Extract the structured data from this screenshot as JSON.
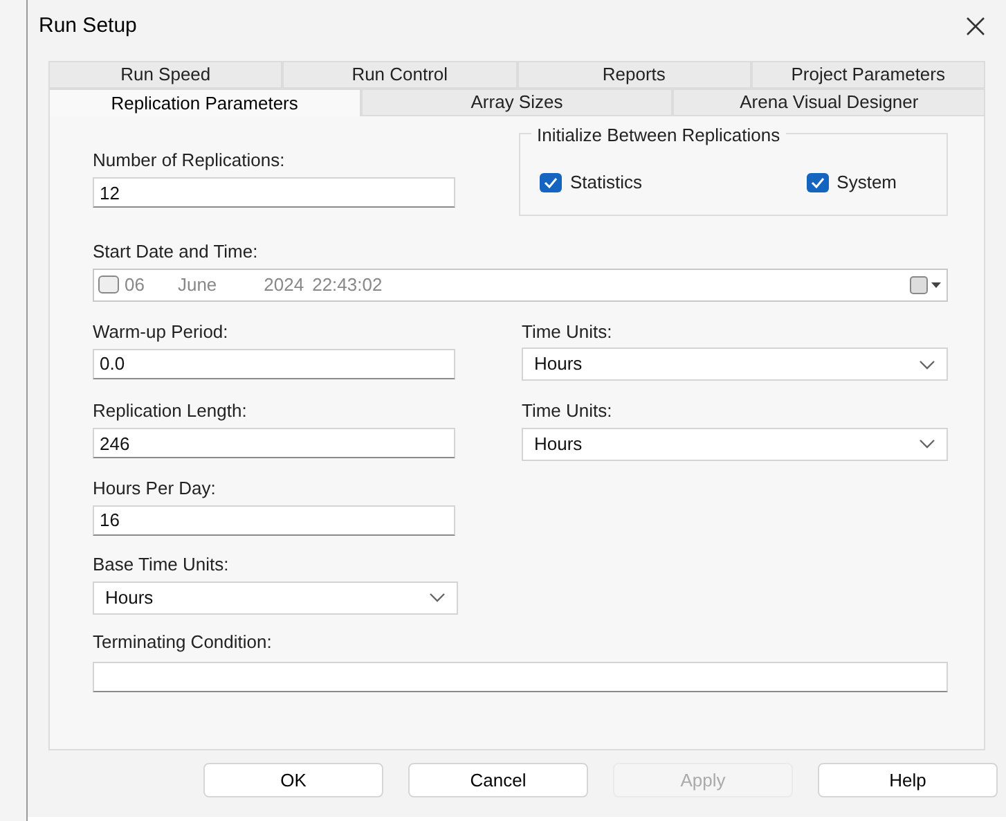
{
  "window": {
    "title": "Run Setup"
  },
  "tab_rows": [
    {
      "tabs": [
        {
          "label": "Run Speed",
          "selected": false
        },
        {
          "label": "Run Control",
          "selected": false
        },
        {
          "label": "Reports",
          "selected": false
        },
        {
          "label": "Project Parameters",
          "selected": false
        }
      ]
    },
    {
      "tabs": [
        {
          "label": "Replication Parameters",
          "selected": true
        },
        {
          "label": "Array Sizes",
          "selected": false
        },
        {
          "label": "Arena Visual Designer",
          "selected": false
        }
      ]
    }
  ],
  "number_of_replications": {
    "label": "Number of Replications:",
    "value": "12"
  },
  "initialize_group": {
    "title": "Initialize Between Replications",
    "options": [
      {
        "label": "Statistics",
        "checked": true
      },
      {
        "label": "System",
        "checked": true
      }
    ]
  },
  "start_date": {
    "label": "Start Date and Time:",
    "checked": false,
    "day": "06",
    "month": "June",
    "year": "2024",
    "time": "22:43:02"
  },
  "warm_up": {
    "label": "Warm-up Period:",
    "value": "0.0",
    "units_label": "Time Units:",
    "units": "Hours"
  },
  "replication_length": {
    "label": "Replication Length:",
    "value": "246",
    "units_label": "Time Units:",
    "units": "Hours"
  },
  "hours_per_day": {
    "label": "Hours Per Day:",
    "value": "16"
  },
  "base_time_units": {
    "label": "Base Time Units:",
    "value": "Hours"
  },
  "terminating_condition": {
    "label": "Terminating Condition:"
  },
  "buttons": [
    {
      "label": "OK",
      "disabled": false
    },
    {
      "label": "Cancel",
      "disabled": false
    },
    {
      "label": "Apply",
      "disabled": true
    },
    {
      "label": "Help",
      "disabled": false
    }
  ]
}
